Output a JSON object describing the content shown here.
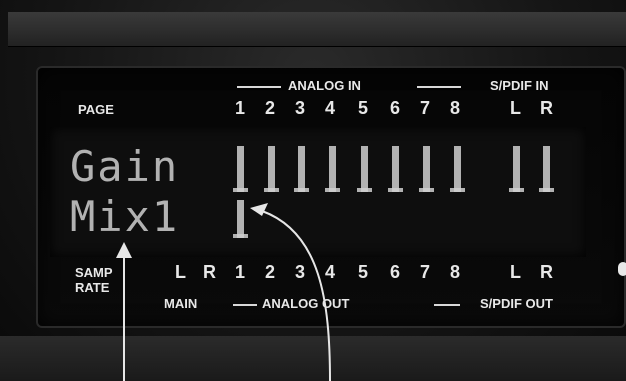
{
  "header": {
    "page_label": "PAGE",
    "analog_in_label": "ANALOG IN",
    "spdif_in_label": "S/PDIF IN",
    "analog_in_channels": [
      "1",
      "2",
      "3",
      "4",
      "5",
      "6",
      "7",
      "8"
    ],
    "spdif_in_channels": [
      "L",
      "R"
    ]
  },
  "lcd": {
    "line1": "Gain",
    "line2": "Mix1",
    "top_meters": [
      "1",
      "2",
      "3",
      "4",
      "5",
      "6",
      "7",
      "8",
      "L",
      "R"
    ],
    "bottom_meters": [
      "1"
    ]
  },
  "footer": {
    "samp_rate_line1": "SAMP",
    "samp_rate_line2": "RATE",
    "main_label": "MAIN",
    "analog_out_label": "ANALOG OUT",
    "spdif_out_label": "S/PDIF OUT",
    "main_channels": [
      "L",
      "R"
    ],
    "analog_out_channels": [
      "1",
      "2",
      "3",
      "4",
      "5",
      "6",
      "7",
      "8"
    ],
    "spdif_out_channels": [
      "L",
      "R"
    ]
  }
}
